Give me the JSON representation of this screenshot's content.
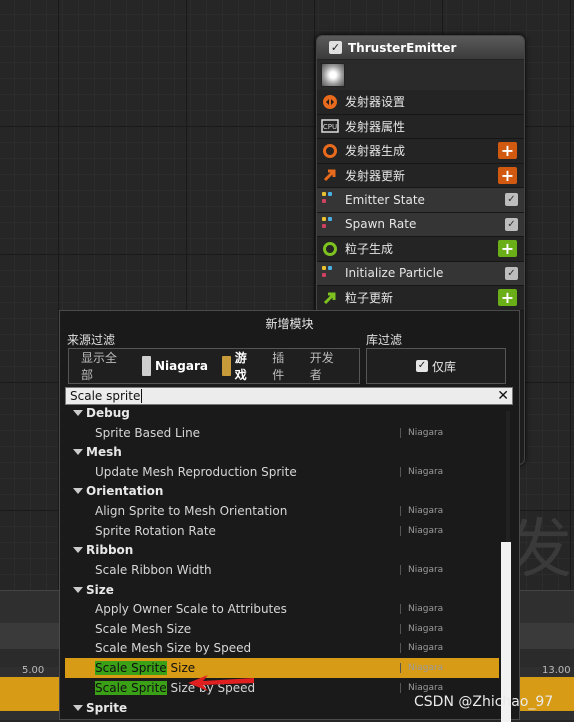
{
  "emitter": {
    "title": "ThrusterEmitter",
    "rows": [
      {
        "label": "发射器设置",
        "kind": "section",
        "icon": "emitter-settings-icon",
        "color": "#e86a1d"
      },
      {
        "label": "发射器属性",
        "kind": "section",
        "icon": "cpu-icon",
        "color": "#dddddd"
      },
      {
        "label": "发射器生成",
        "kind": "section",
        "icon": "emitter-spawn-icon",
        "color": "#e86a1d",
        "add_color": "#d25a10"
      },
      {
        "label": "发射器更新",
        "kind": "section",
        "icon": "emitter-update-icon",
        "color": "#e86a1d",
        "add_color": "#d25a10"
      },
      {
        "label": "Emitter State",
        "kind": "module"
      },
      {
        "label": "Spawn Rate",
        "kind": "module"
      },
      {
        "label": "粒子生成",
        "kind": "section",
        "icon": "particle-spawn-icon",
        "color": "#7dc21f",
        "add_color": "#6aae18"
      },
      {
        "label": "Initialize Particle",
        "kind": "module"
      },
      {
        "label": "粒子更新",
        "kind": "section",
        "icon": "particle-update-icon",
        "color": "#7dc21f",
        "add_color": "#6aae18"
      }
    ]
  },
  "popup": {
    "title": "新增模块",
    "source_filter_label": "来源过滤",
    "library_filter_label": "库过滤",
    "source_filters": [
      {
        "label": "显示全部",
        "active": false
      },
      {
        "label": "Niagara",
        "active": true,
        "swatch": "#cfcfcf"
      },
      {
        "label": "游戏",
        "active": true,
        "swatch": "#c79a3a"
      },
      {
        "label": "插件",
        "active": false
      },
      {
        "label": "开发者",
        "active": false
      }
    ],
    "library_only_label": "仅库",
    "search_value": "Scale sprite",
    "categories": [
      {
        "name": "Debug",
        "items": [
          {
            "label": "Sprite Based Line",
            "source": "Niagara"
          }
        ]
      },
      {
        "name": "Mesh",
        "items": [
          {
            "label": "Update Mesh Reproduction Sprite",
            "source": "Niagara"
          }
        ]
      },
      {
        "name": "Orientation",
        "items": [
          {
            "label": "Align Sprite to Mesh Orientation",
            "source": "Niagara"
          },
          {
            "label": "Sprite Rotation Rate",
            "source": "Niagara"
          }
        ]
      },
      {
        "name": "Ribbon",
        "items": [
          {
            "label": "Scale Ribbon Width",
            "source": "Niagara"
          }
        ]
      },
      {
        "name": "Size",
        "items": [
          {
            "label": "Apply Owner Scale to Attributes",
            "source": "Niagara"
          },
          {
            "label": "Scale Mesh Size",
            "source": "Niagara"
          },
          {
            "label": "Scale Mesh Size by Speed",
            "source": "Niagara"
          },
          {
            "label": "Scale Sprite Size",
            "source": "Niagara",
            "selected": true,
            "match": "Scale Sprite",
            "rest": " Size"
          },
          {
            "label": "Scale Sprite Size by Speed",
            "source": "Niagara",
            "match": "Scale Sprite",
            "rest": " Size by Speed"
          }
        ]
      },
      {
        "name": "Sprite",
        "items": []
      }
    ]
  },
  "timeline": {
    "mark_left": "5.00",
    "mark_right": "13.00"
  },
  "background_glyph": "发",
  "watermark": "CSDN @Zhichao_97"
}
